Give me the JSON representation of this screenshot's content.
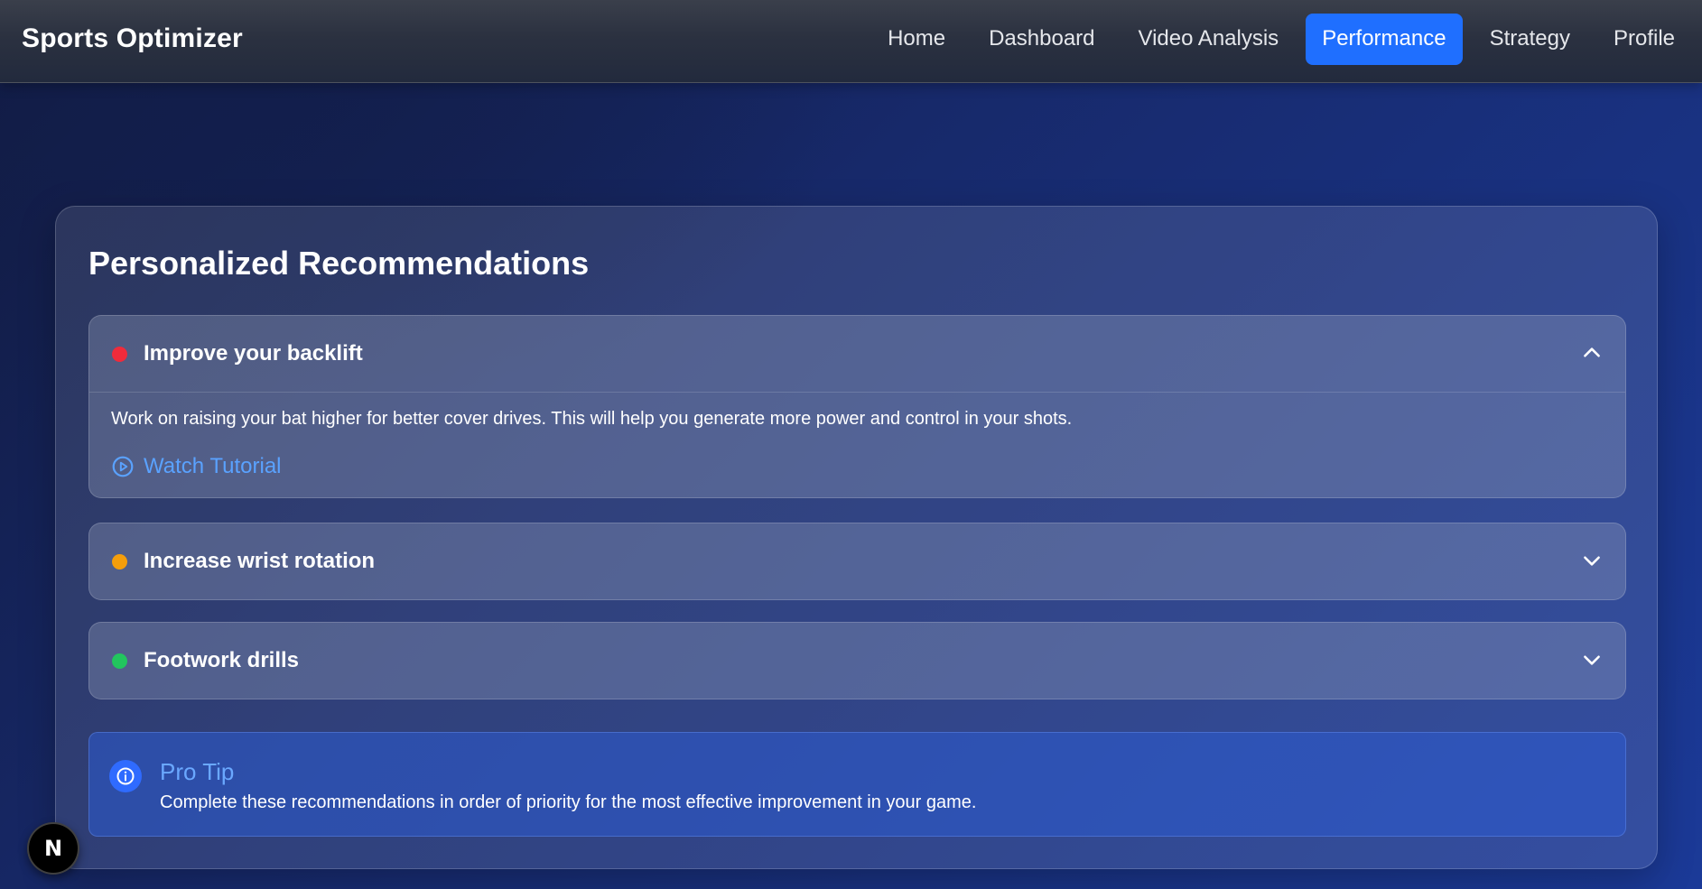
{
  "app": {
    "brand": "Sports Optimizer"
  },
  "nav": {
    "items": [
      {
        "label": "Home",
        "active": false
      },
      {
        "label": "Dashboard",
        "active": false
      },
      {
        "label": "Video Analysis",
        "active": false
      },
      {
        "label": "Performance",
        "active": true
      },
      {
        "label": "Strategy",
        "active": false
      },
      {
        "label": "Profile",
        "active": false
      }
    ],
    "accent_color": "#1f6fff"
  },
  "main": {
    "title": "Personalized Recommendations",
    "recommendations": [
      {
        "title": "Improve your backlift",
        "priority_color": "#ef2b3b",
        "expanded": true,
        "chevron_icon": "chevron-up-icon",
        "description": "Work on raising your bat higher for better cover drives. This will help you generate more power and control in your shots.",
        "tutorial_label": "Watch Tutorial",
        "tutorial_icon": "play-circle-icon"
      },
      {
        "title": "Increase wrist rotation",
        "priority_color": "#f59e0b",
        "expanded": false,
        "chevron_icon": "chevron-down-icon"
      },
      {
        "title": "Footwork drills",
        "priority_color": "#22c55e",
        "expanded": false,
        "chevron_icon": "chevron-down-icon"
      }
    ],
    "tip": {
      "icon": "info-icon",
      "title": "Pro Tip",
      "text": "Complete these recommendations in order of priority for the most effective improvement in your game."
    }
  },
  "floating_badge": {
    "letter": "N"
  }
}
